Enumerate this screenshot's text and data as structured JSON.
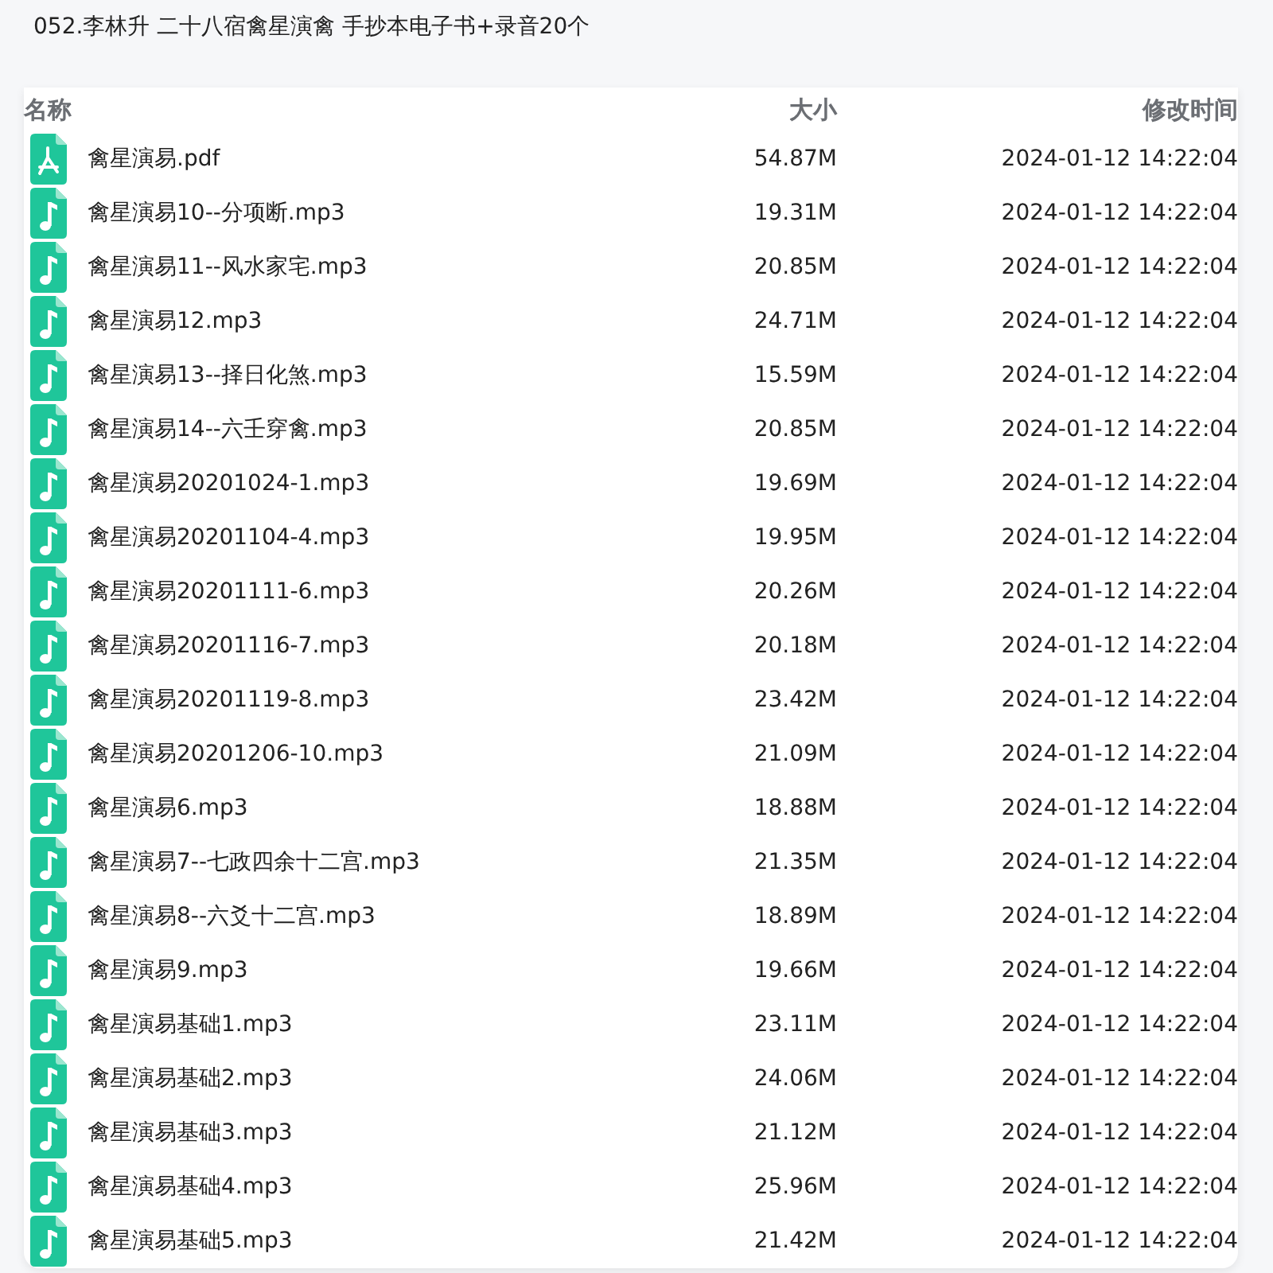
{
  "title": "052.李林升 二十八宿禽星演禽 手抄本电子书+录音20个",
  "columns": [
    "名称",
    "大小",
    "修改时间"
  ],
  "files": [
    {
      "kind": "pdf",
      "name": "禽星演易.pdf",
      "size": "54.87M",
      "modified": "2024-01-12 14:22:04"
    },
    {
      "kind": "audio",
      "name": "禽星演易10--分项断.mp3",
      "size": "19.31M",
      "modified": "2024-01-12 14:22:04"
    },
    {
      "kind": "audio",
      "name": "禽星演易11--风水家宅.mp3",
      "size": "20.85M",
      "modified": "2024-01-12 14:22:04"
    },
    {
      "kind": "audio",
      "name": "禽星演易12.mp3",
      "size": "24.71M",
      "modified": "2024-01-12 14:22:04"
    },
    {
      "kind": "audio",
      "name": "禽星演易13--择日化煞.mp3",
      "size": "15.59M",
      "modified": "2024-01-12 14:22:04"
    },
    {
      "kind": "audio",
      "name": "禽星演易14--六壬穿禽.mp3",
      "size": "20.85M",
      "modified": "2024-01-12 14:22:04"
    },
    {
      "kind": "audio",
      "name": "禽星演易20201024-1.mp3",
      "size": "19.69M",
      "modified": "2024-01-12 14:22:04"
    },
    {
      "kind": "audio",
      "name": "禽星演易20201104-4.mp3",
      "size": "19.95M",
      "modified": "2024-01-12 14:22:04"
    },
    {
      "kind": "audio",
      "name": "禽星演易20201111-6.mp3",
      "size": "20.26M",
      "modified": "2024-01-12 14:22:04"
    },
    {
      "kind": "audio",
      "name": "禽星演易20201116-7.mp3",
      "size": "20.18M",
      "modified": "2024-01-12 14:22:04"
    },
    {
      "kind": "audio",
      "name": "禽星演易20201119-8.mp3",
      "size": "23.42M",
      "modified": "2024-01-12 14:22:04"
    },
    {
      "kind": "audio",
      "name": "禽星演易20201206-10.mp3",
      "size": "21.09M",
      "modified": "2024-01-12 14:22:04"
    },
    {
      "kind": "audio",
      "name": "禽星演易6.mp3",
      "size": "18.88M",
      "modified": "2024-01-12 14:22:04"
    },
    {
      "kind": "audio",
      "name": "禽星演易7--七政四余十二宫.mp3",
      "size": "21.35M",
      "modified": "2024-01-12 14:22:04"
    },
    {
      "kind": "audio",
      "name": "禽星演易8--六爻十二宫.mp3",
      "size": "18.89M",
      "modified": "2024-01-12 14:22:04"
    },
    {
      "kind": "audio",
      "name": "禽星演易9.mp3",
      "size": "19.66M",
      "modified": "2024-01-12 14:22:04"
    },
    {
      "kind": "audio",
      "name": "禽星演易基础1.mp3",
      "size": "23.11M",
      "modified": "2024-01-12 14:22:04"
    },
    {
      "kind": "audio",
      "name": "禽星演易基础2.mp3",
      "size": "24.06M",
      "modified": "2024-01-12 14:22:04"
    },
    {
      "kind": "audio",
      "name": "禽星演易基础3.mp3",
      "size": "21.12M",
      "modified": "2024-01-12 14:22:04"
    },
    {
      "kind": "audio",
      "name": "禽星演易基础4.mp3",
      "size": "25.96M",
      "modified": "2024-01-12 14:22:04"
    },
    {
      "kind": "audio",
      "name": "禽星演易基础5.mp3",
      "size": "21.42M",
      "modified": "2024-01-12 14:22:04"
    }
  ]
}
